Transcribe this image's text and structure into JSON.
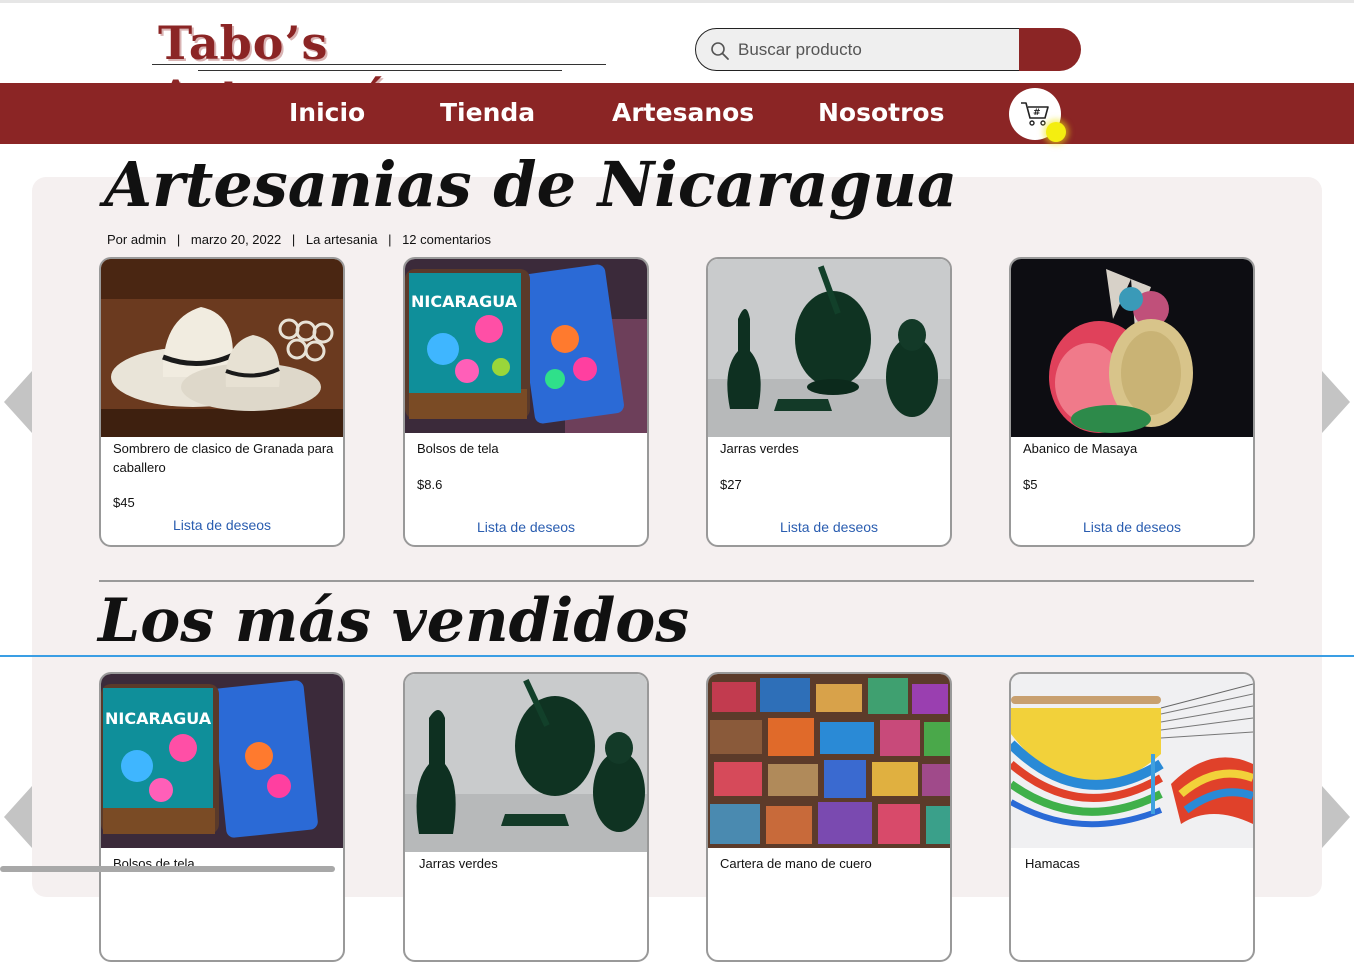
{
  "header": {
    "brand": "Tabo’s Artesanías",
    "search": {
      "placeholder": "Buscar producto"
    }
  },
  "nav": {
    "items": [
      "Inicio",
      "Tienda",
      "Artesanos",
      "Nosotros"
    ]
  },
  "hero": {
    "title": "Artesanias de Nicaragua",
    "meta": {
      "author": "Por admin",
      "date": "marzo 20, 2022",
      "category": "La artesania",
      "comments": "12 comentarios",
      "separator": "|"
    }
  },
  "featured": [
    {
      "name": "Sombrero de clasico de Granada para caballero",
      "price": "$45",
      "wishlist": "Lista de deseos",
      "image": "white-hats"
    },
    {
      "name": "Bolsos de tela",
      "price": "$8.6",
      "wishlist": "Lista de deseos",
      "image": "embroidered-bags"
    },
    {
      "name": "Jarras verdes",
      "price": "$27",
      "wishlist": "Lista de deseos",
      "image": "green-ceramics"
    },
    {
      "name": "Abanico de Masaya",
      "price": "$5",
      "wishlist": "Lista de deseos",
      "image": "woven-fans"
    }
  ],
  "bestsellers": {
    "title": "Los más vendidos",
    "items": [
      {
        "name": "Bolsos de tela",
        "image": "embroidered-bags"
      },
      {
        "name": "Jarras verdes",
        "image": "green-ceramics"
      },
      {
        "name": "Cartera de mano de cuero",
        "image": "leather-wallets"
      },
      {
        "name": "Hamacas",
        "image": "hammock"
      }
    ]
  },
  "overlay": {
    "embroidery_text": "NICARAGUA",
    "cart_tag": "#"
  },
  "colors": {
    "brand": "#8b2525",
    "link": "#2a5db0",
    "panel": "#f5f0f0",
    "guide": "#3a9ee4",
    "cursor": "#f4ee10"
  }
}
